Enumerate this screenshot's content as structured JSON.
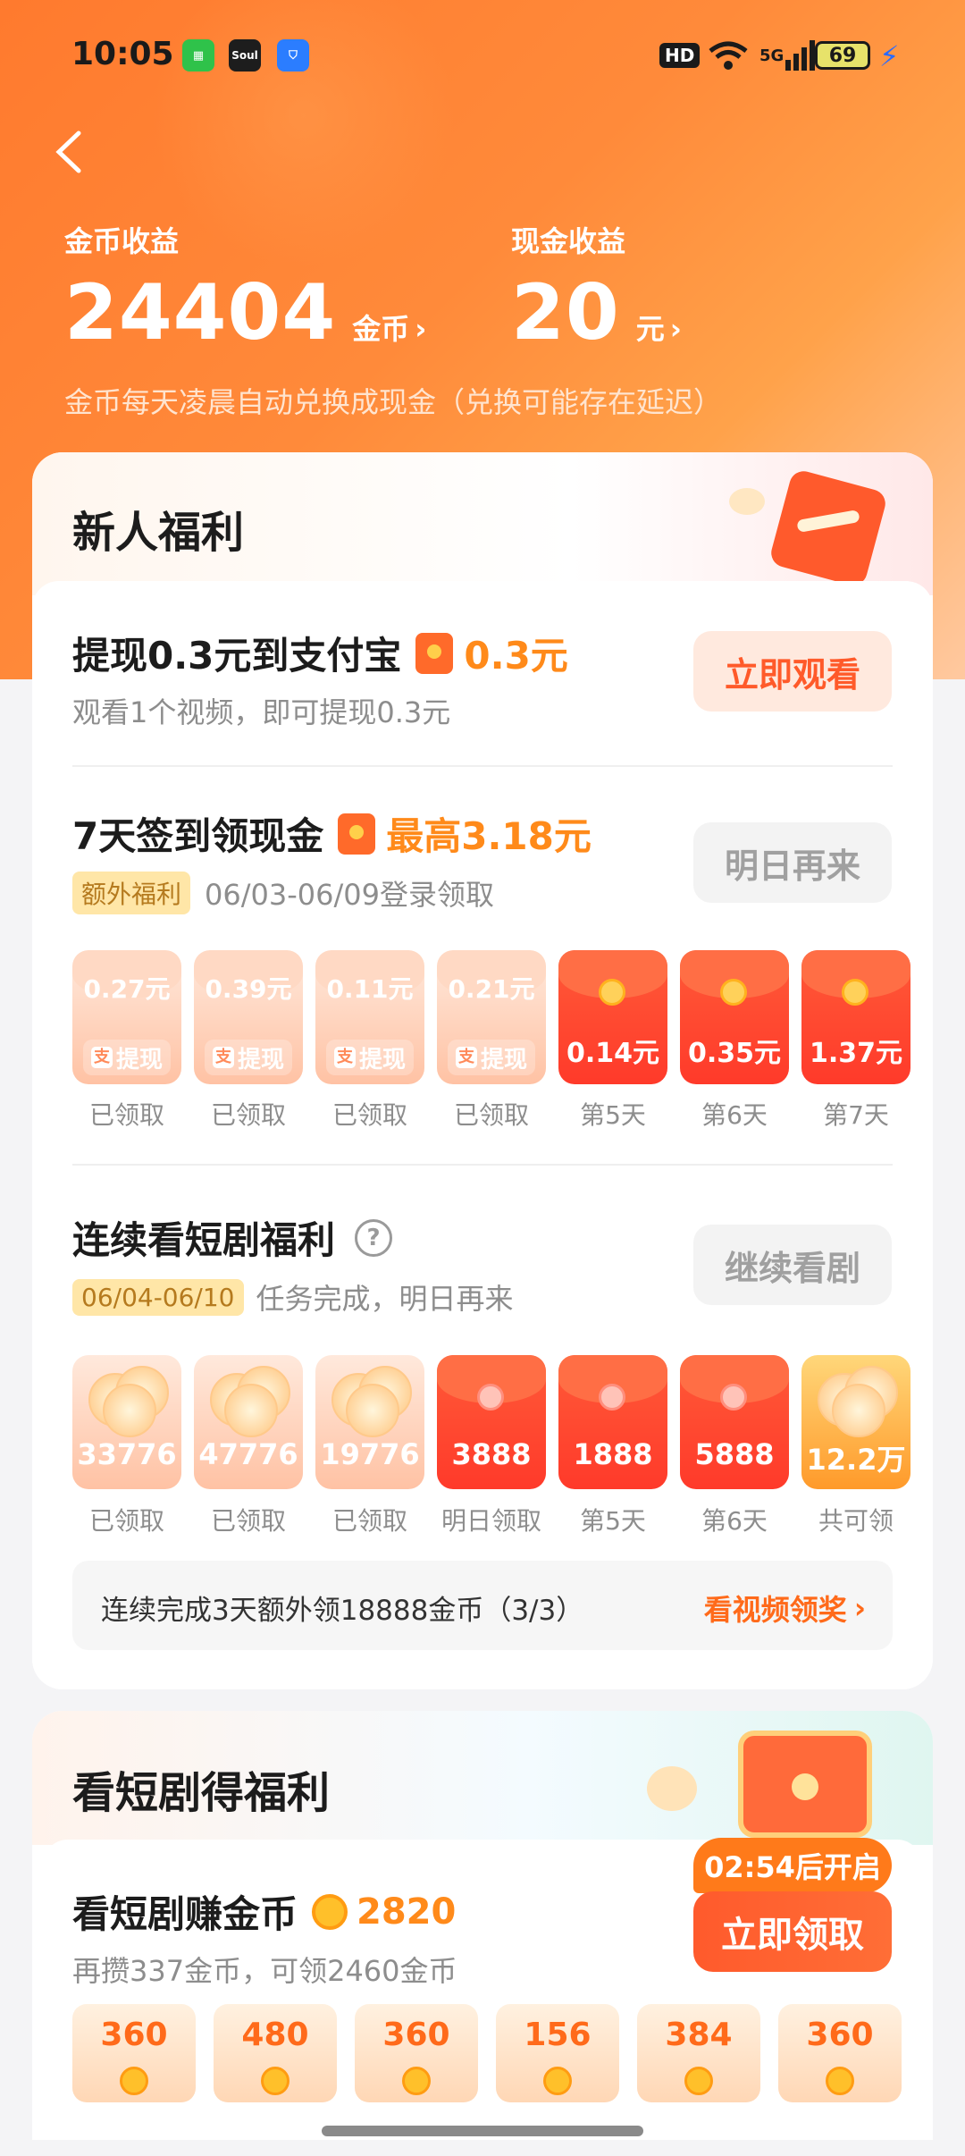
{
  "status_bar": {
    "time": "10:05",
    "apps": [
      "wechat-like",
      "Soul",
      "shield"
    ],
    "soul_label": "Soul",
    "hd": "HD",
    "network": "5G",
    "battery": "69"
  },
  "earnings": {
    "coin_label": "金币收益",
    "coin_value": "24404",
    "coin_unit": "金币",
    "cash_label": "现金收益",
    "cash_value": "20",
    "cash_unit": "元",
    "note": "金币每天凌晨自动兑换成现金（兑换可能存在延迟）"
  },
  "newbie": {
    "title": "新人福利",
    "withdraw": {
      "title": "提现0.3元到支付宝",
      "amount": "0.3元",
      "sub": "观看1个视频，即可提现0.3元",
      "button": "立即观看"
    },
    "checkin": {
      "title": "7天签到领现金",
      "amount": "最高3.18元",
      "tag": "额外福利",
      "sub": "06/03-06/09登录领取",
      "button": "明日再来",
      "pay_label": "提现",
      "days": [
        {
          "amount": "0.27元",
          "label": "已领取",
          "state": "done"
        },
        {
          "amount": "0.39元",
          "label": "已领取",
          "state": "done"
        },
        {
          "amount": "0.11元",
          "label": "已领取",
          "state": "done"
        },
        {
          "amount": "0.21元",
          "label": "已领取",
          "state": "done"
        },
        {
          "amount": "0.14元",
          "label": "第5天",
          "state": "red"
        },
        {
          "amount": "0.35元",
          "label": "第6天",
          "state": "red"
        },
        {
          "amount": "1.37元",
          "label": "第7天",
          "state": "red"
        }
      ]
    },
    "drama": {
      "title": "连续看短剧福利",
      "help": "?",
      "tag": "06/04-06/10",
      "sub": "任务完成，明日再来",
      "button": "继续看剧",
      "days": [
        {
          "amount": "33776",
          "label": "已领取",
          "state": "done"
        },
        {
          "amount": "47776",
          "label": "已领取",
          "state": "done"
        },
        {
          "amount": "19776",
          "label": "已领取",
          "state": "done"
        },
        {
          "amount": "3888",
          "label": "明日领取",
          "state": "red"
        },
        {
          "amount": "1888",
          "label": "第5天",
          "state": "red"
        },
        {
          "amount": "5888",
          "label": "第6天",
          "state": "red"
        },
        {
          "amount": "12.2万",
          "label": "共可领",
          "state": "gold"
        }
      ],
      "bonus_text": "连续完成3天额外领18888金币（3/3）",
      "bonus_link": "看视频领奖"
    }
  },
  "drama_earn": {
    "title": "看短剧得福利",
    "row_title": "看短剧赚金币",
    "coins": "2820",
    "sub": "再攒337金币，可领2460金币",
    "timer": "02:54后开启",
    "button": "立即领取",
    "tiles": [
      "360",
      "480",
      "360",
      "156",
      "384",
      "360"
    ]
  },
  "colors": {
    "accent": "#ff5a2a",
    "gold": "#ff8a1a",
    "hero_start": "#ff7a2e"
  }
}
